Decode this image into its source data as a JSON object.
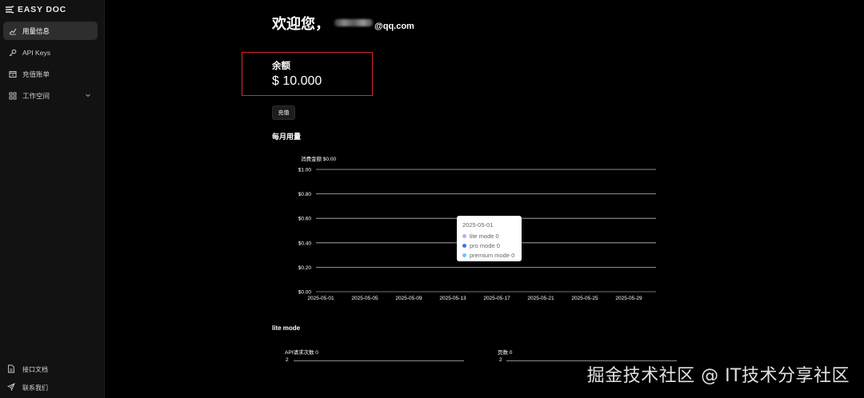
{
  "app": {
    "logo_text": "EASY DOC"
  },
  "sidebar": {
    "items": [
      {
        "label": "用量信息",
        "icon": "trend-chart-icon",
        "active": true
      },
      {
        "label": "API Keys",
        "icon": "key-icon",
        "active": false
      },
      {
        "label": "充值账单",
        "icon": "receipt-icon",
        "active": false
      },
      {
        "label": "工作空间",
        "icon": "grid-icon",
        "active": false,
        "has_submenu": true
      }
    ],
    "footer": [
      {
        "label": "接口文档",
        "icon": "document-icon"
      },
      {
        "label": "联系我们",
        "icon": "send-icon"
      }
    ]
  },
  "main": {
    "welcome_prefix": "欢迎您，",
    "email_visible_suffix": "@qq.com",
    "balance": {
      "label": "余额",
      "value": "$ 10.000"
    },
    "recharge_button": "充值",
    "monthly_usage_title": "每月用量",
    "lite_mode_title": "lite mode"
  },
  "chart_data": [
    {
      "type": "bar",
      "title": "消费金额 $0.00",
      "categories": [
        "2025-05-01",
        "2025-05-05",
        "2025-05-09",
        "2025-05-13",
        "2025-05-17",
        "2025-05-21",
        "2025-05-25",
        "2025-05-29"
      ],
      "series": [
        {
          "name": "lite mode",
          "values": [
            0,
            0,
            0,
            0,
            0,
            0,
            0,
            0
          ]
        },
        {
          "name": "pro mode",
          "values": [
            0,
            0,
            0,
            0,
            0,
            0,
            0,
            0
          ]
        },
        {
          "name": "premium mode",
          "values": [
            0,
            0,
            0,
            0,
            0,
            0,
            0,
            0
          ]
        }
      ],
      "yticks": [
        "$0.00",
        "$0.20",
        "$0.40",
        "$0.60",
        "$0.80",
        "$1.00"
      ],
      "ylim": [
        0,
        1
      ],
      "grid": true,
      "tooltip": {
        "title": "2025-05-01",
        "rows": [
          {
            "label": "lite mode 0",
            "color": "#c8a8f0"
          },
          {
            "label": "pro mode 0",
            "color": "#4a6cf7"
          },
          {
            "label": "premium mode 0",
            "color": "#6ec6f5"
          }
        ]
      }
    },
    {
      "type": "line",
      "title": "API请求次数 0",
      "ytick": "2"
    },
    {
      "type": "line",
      "title": "页数 0",
      "ytick": "2"
    }
  ],
  "watermark": "掘金技术社区 @ IT技术分享社区",
  "colors": {
    "background": "#000000",
    "sidebar": "#121212",
    "highlight_box": "#d8262b"
  }
}
